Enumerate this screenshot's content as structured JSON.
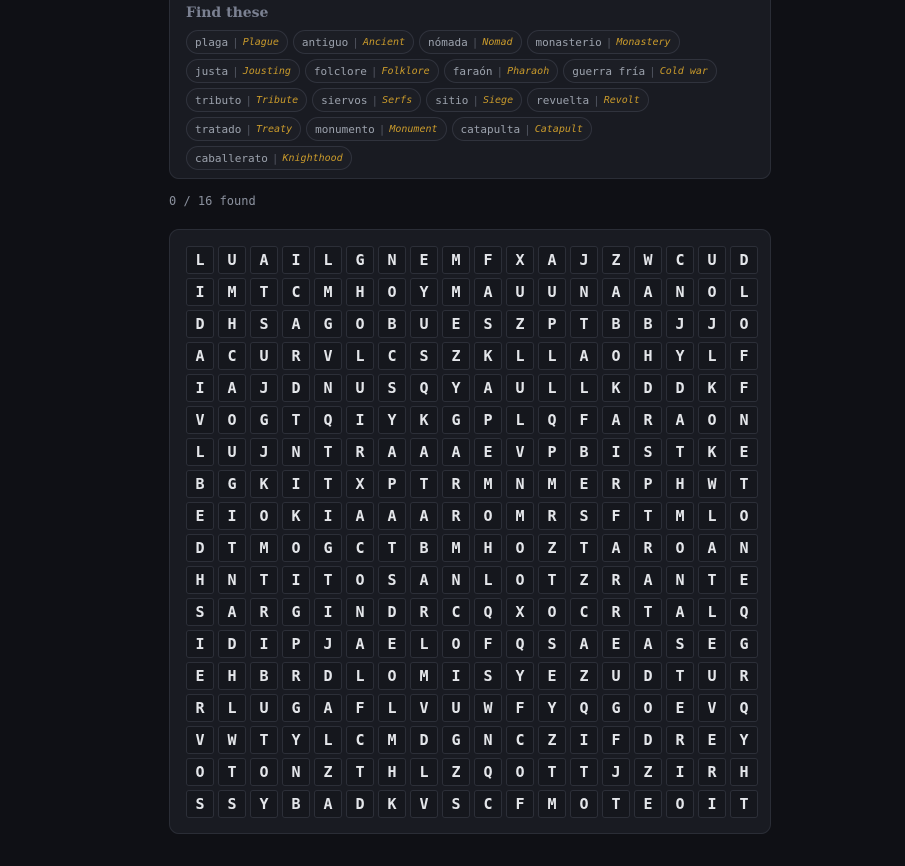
{
  "bank": {
    "title": "Find these",
    "words": [
      {
        "es": "plaga",
        "en": "Plague"
      },
      {
        "es": "antiguo",
        "en": "Ancient"
      },
      {
        "es": "nómada",
        "en": "Nomad"
      },
      {
        "es": "monasterio",
        "en": "Monastery"
      },
      {
        "es": "justa",
        "en": "Jousting"
      },
      {
        "es": "folclore",
        "en": "Folklore"
      },
      {
        "es": "faraón",
        "en": "Pharaoh"
      },
      {
        "es": "guerra fría",
        "en": "Cold war"
      },
      {
        "es": "tributo",
        "en": "Tribute"
      },
      {
        "es": "siervos",
        "en": "Serfs"
      },
      {
        "es": "sitio",
        "en": "Siege"
      },
      {
        "es": "revuelta",
        "en": "Revolt"
      },
      {
        "es": "tratado",
        "en": "Treaty"
      },
      {
        "es": "monumento",
        "en": "Monument"
      },
      {
        "es": "catapulta",
        "en": "Catapult"
      },
      {
        "es": "caballerato",
        "en": "Knighthood"
      }
    ],
    "separator": "|"
  },
  "status": {
    "found_text": "0 / 16 found"
  },
  "grid": {
    "rows": [
      "LUAILGNEMFXAJZWCUD",
      "IMTCMHOYMAUUNAANOL",
      "DHSAGOBUESZPTBBJJO",
      "ACURVLCSZKLLAOHYLF",
      "IAJDNUSQYAULLKDDKF",
      "VOGTQIYKGPLQFARAON",
      "LUJNTRAAAEVPBISTKE",
      "BGKITXPTRMNMERPHWT",
      "EIOKIAAAROMRSFTMLO",
      "DTMOGCTBMHOZTAROAN",
      "HNTITOSANLOTZRANTE",
      "SARGINDRCQXOCRTALQ",
      "IDIPJAELOFQSAEASEG",
      "EHBRDLOMISYEZUDTUR",
      "RLUGAFLVUWFYQGOEVQ",
      "VWTYLCMDGNCZIFDREY",
      "OTONZTHLZQOTTJZIRH",
      "SSYBADKVSCFMOTEOIT"
    ]
  }
}
